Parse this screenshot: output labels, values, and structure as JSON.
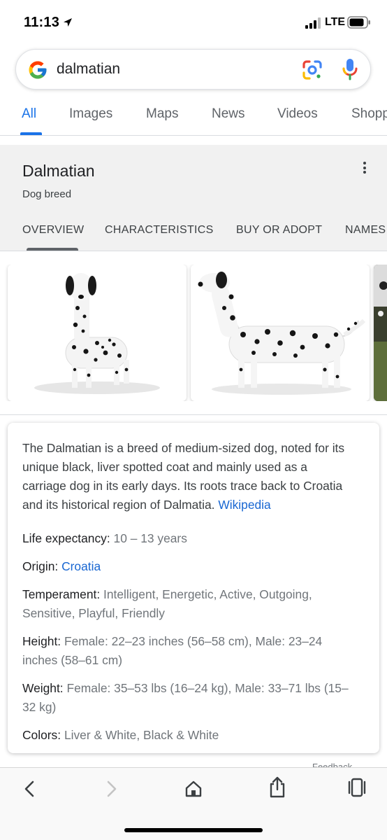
{
  "status_bar": {
    "time": "11:13",
    "network": "LTE"
  },
  "search": {
    "query": "dalmatian"
  },
  "tabs": [
    {
      "label": "All",
      "active": true
    },
    {
      "label": "Images",
      "active": false
    },
    {
      "label": "Maps",
      "active": false
    },
    {
      "label": "News",
      "active": false
    },
    {
      "label": "Videos",
      "active": false
    },
    {
      "label": "Shopping",
      "active": false
    }
  ],
  "knowledge_panel": {
    "title": "Dalmatian",
    "subtitle": "Dog breed",
    "tabs": [
      "OVERVIEW",
      "CHARACTERISTICS",
      "BUY OR ADOPT",
      "NAMES"
    ],
    "active_tab": "OVERVIEW"
  },
  "description": {
    "text": "The Dalmatian is a breed of medium-sized dog, noted for its unique black, liver spotted coat and mainly used as a carriage dog in its early days. Its roots trace back to Croatia and its historical region of Dalmatia.",
    "source": "Wikipedia"
  },
  "attributes": [
    {
      "label": "Life expectancy:",
      "value": "10 – 13 years"
    },
    {
      "label": "Origin:",
      "value": "Croatia"
    },
    {
      "label": "Temperament:",
      "value": "Intelligent, Energetic, Active, Outgoing, Sensitive, Playful, Friendly"
    },
    {
      "label": "Height:",
      "value": "Female: 22–23 inches (56–58 cm), Male: 23–24 inches (58–61 cm)"
    },
    {
      "label": "Weight:",
      "value": "Female: 35–53 lbs (16–24 kg), Male: 33–71 lbs (15–32 kg)"
    },
    {
      "label": "Colors:",
      "value": "Liver & White, Black & White"
    }
  ],
  "feedback_label": "Feedback",
  "colors": {
    "accent": "#1a73e8",
    "link": "#1967d2",
    "panel_bg": "#f1f1f1"
  }
}
